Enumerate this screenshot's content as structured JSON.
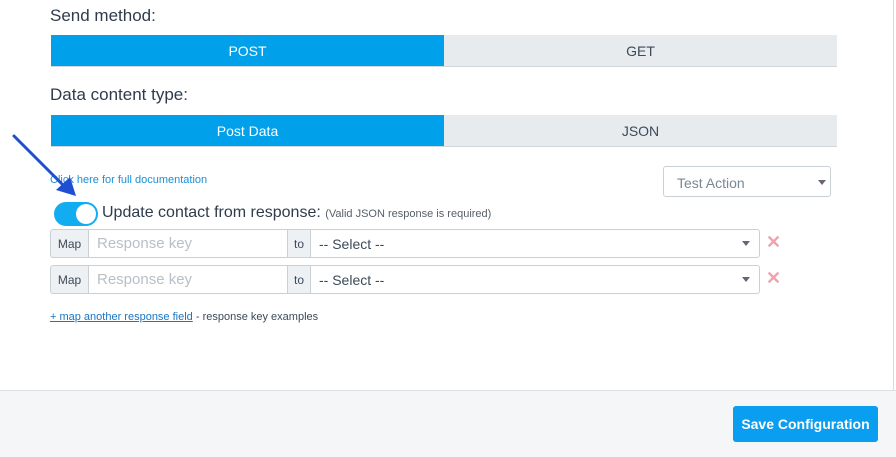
{
  "send_method": {
    "label": "Send method:",
    "options": [
      "POST",
      "GET"
    ],
    "selected": "POST"
  },
  "content_type": {
    "label": "Data content type:",
    "options": [
      "Post Data",
      "JSON"
    ],
    "selected": "Post Data"
  },
  "doc_link": "Click here for full documentation",
  "test_action": {
    "value": "Test Action"
  },
  "update_contact": {
    "enabled": true,
    "label": "Update contact from response:",
    "note": "(Valid JSON response is required)"
  },
  "mappings": [
    {
      "map_label": "Map",
      "key_placeholder": "Response key",
      "to_label": "to",
      "select_value": "-- Select --"
    },
    {
      "map_label": "Map",
      "key_placeholder": "Response key",
      "to_label": "to",
      "select_value": "-- Select --"
    }
  ],
  "map_another": {
    "link": "+ map another response field",
    "suffix": " - response key examples"
  },
  "remove_icon": "close-x-icon",
  "annotation_arrow_color": "#1f4fd1",
  "accent_color": "#00a0ea",
  "footer": {
    "save_label": "Save Configuration"
  }
}
